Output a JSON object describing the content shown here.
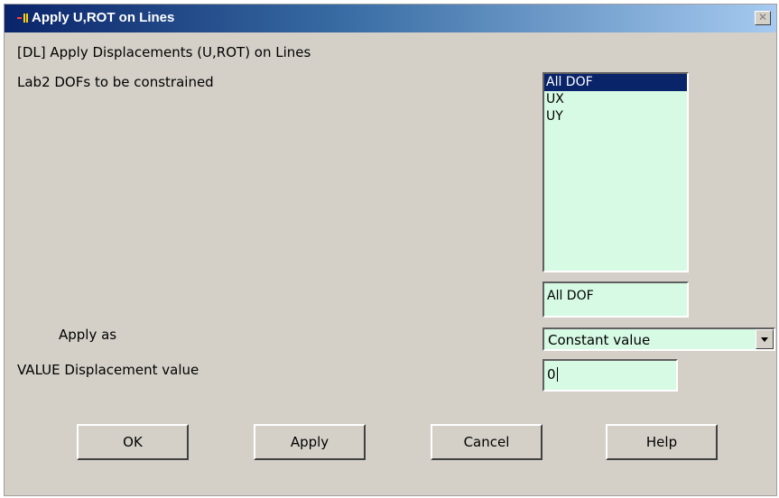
{
  "window": {
    "title": "Apply U,ROT on Lines",
    "close_glyph": "✕"
  },
  "header": {
    "command_description": "[DL]  Apply Displacements (U,ROT) on Lines"
  },
  "lab2": {
    "label": "Lab2    DOFs to be constrained",
    "options": [
      "All DOF",
      "UX",
      "UY"
    ],
    "selected_index": 0,
    "selection_echo": "All DOF"
  },
  "apply_as": {
    "label": "Apply as",
    "selected": "Constant value"
  },
  "value": {
    "label": "VALUE   Displacement value",
    "current": "0"
  },
  "buttons": {
    "ok": "OK",
    "apply": "Apply",
    "cancel": "Cancel",
    "help": "Help"
  },
  "colors": {
    "field_background": "#d7fae4",
    "selection": "#0a246a",
    "dialog_background": "#d4d0c8"
  },
  "icons": {
    "title_icon": "ansys-logo-icon",
    "close": "close-icon",
    "dropdown": "chevron-down-icon"
  }
}
